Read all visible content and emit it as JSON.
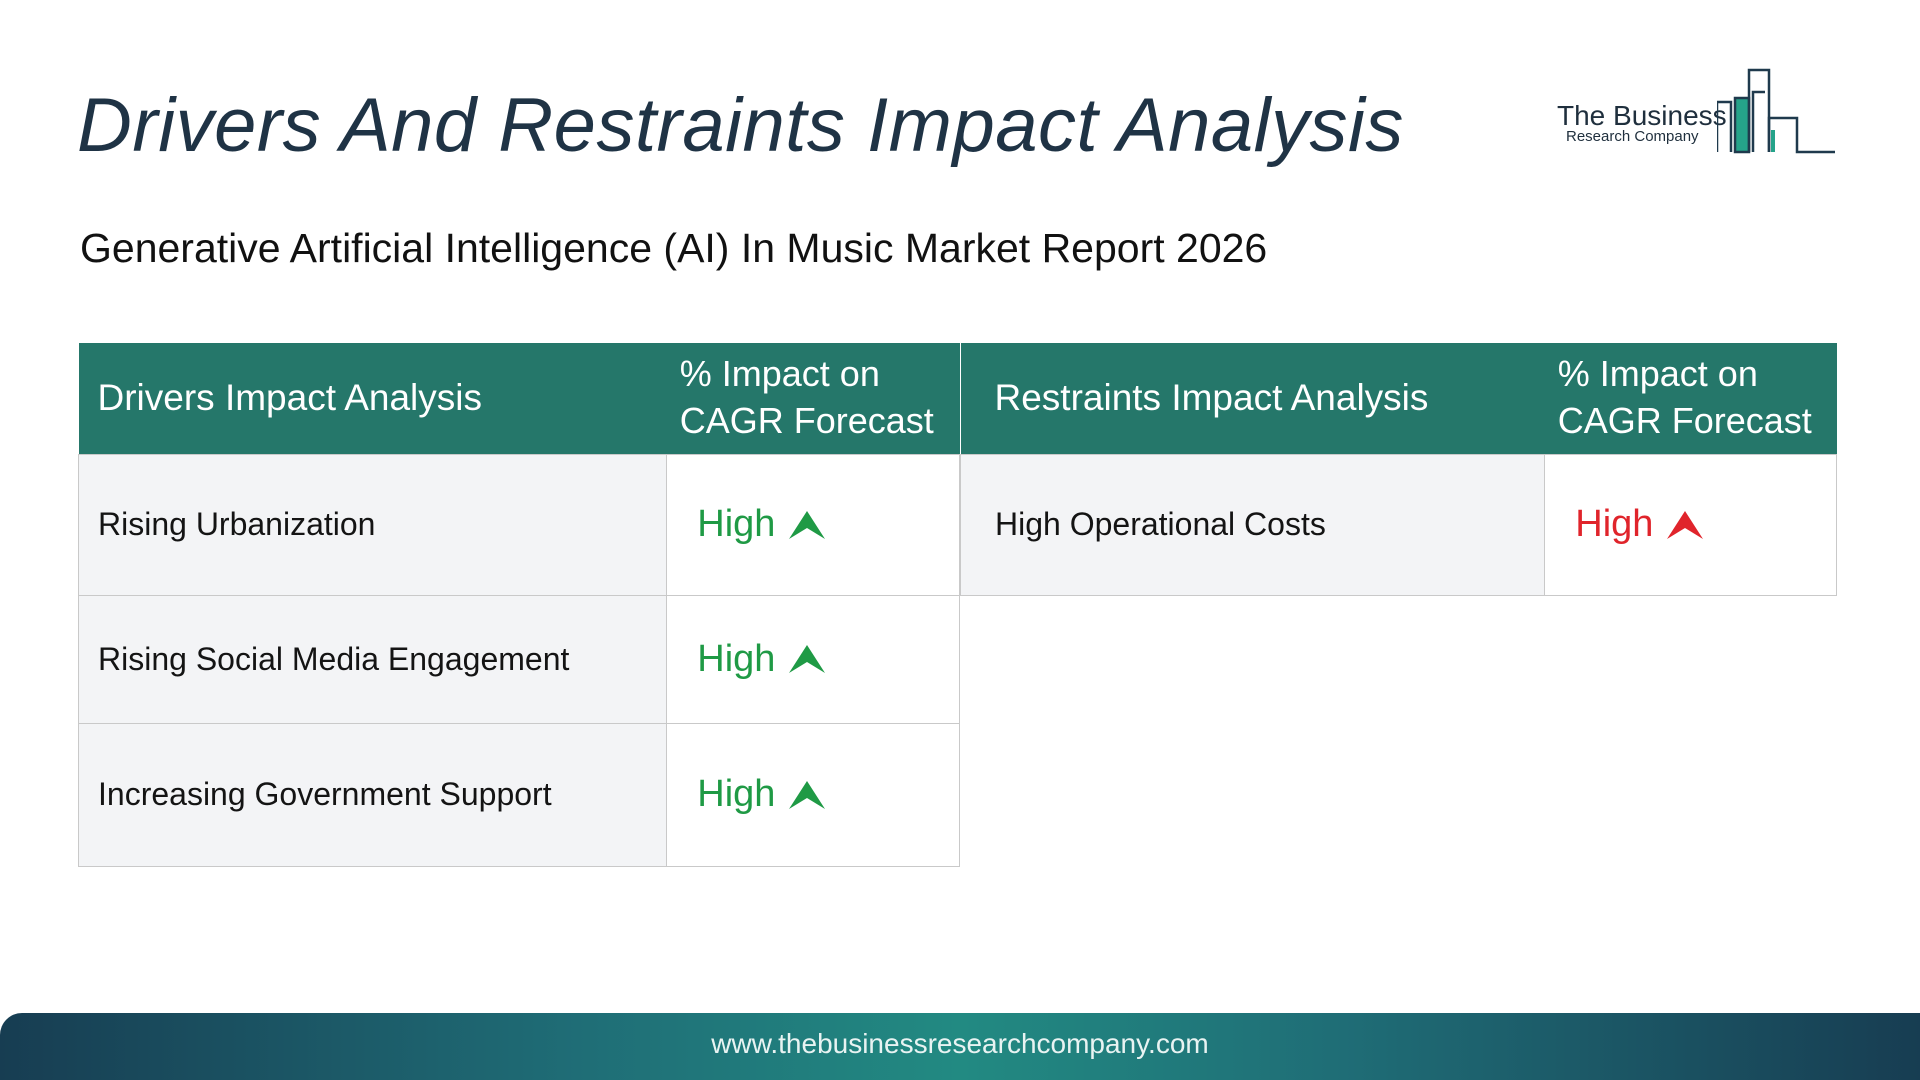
{
  "header": {
    "title": "Drivers And Restraints Impact Analysis",
    "subtitle": "Generative Artificial Intelligence (AI) In Music Market Report 2026"
  },
  "logo": {
    "name": "The Business",
    "tagline": "Research Company"
  },
  "drivers_table": {
    "headers": [
      "Drivers Impact Analysis",
      "% Impact on CAGR Forecast"
    ],
    "rows": [
      {
        "factor": "Rising Urbanization",
        "impact": "High",
        "direction": "up"
      },
      {
        "factor": "Rising Social Media Engagement",
        "impact": "High",
        "direction": "up"
      },
      {
        "factor": "Increasing Government Support",
        "impact": "High",
        "direction": "up"
      }
    ],
    "impact_color": "#1f9a45"
  },
  "restraints_table": {
    "headers": [
      "Restraints Impact Analysis",
      "% Impact on CAGR Forecast"
    ],
    "rows": [
      {
        "factor": "High Operational Costs",
        "impact": "High",
        "direction": "up"
      }
    ],
    "impact_color": "#e0242b"
  },
  "colors": {
    "header_bg": "#25776a",
    "title_text": "#1f3345",
    "footer_gradient": [
      "#173d52",
      "#228a82",
      "#173d52"
    ]
  },
  "footer": {
    "url": "www.thebusinessresearchcompany.com"
  }
}
